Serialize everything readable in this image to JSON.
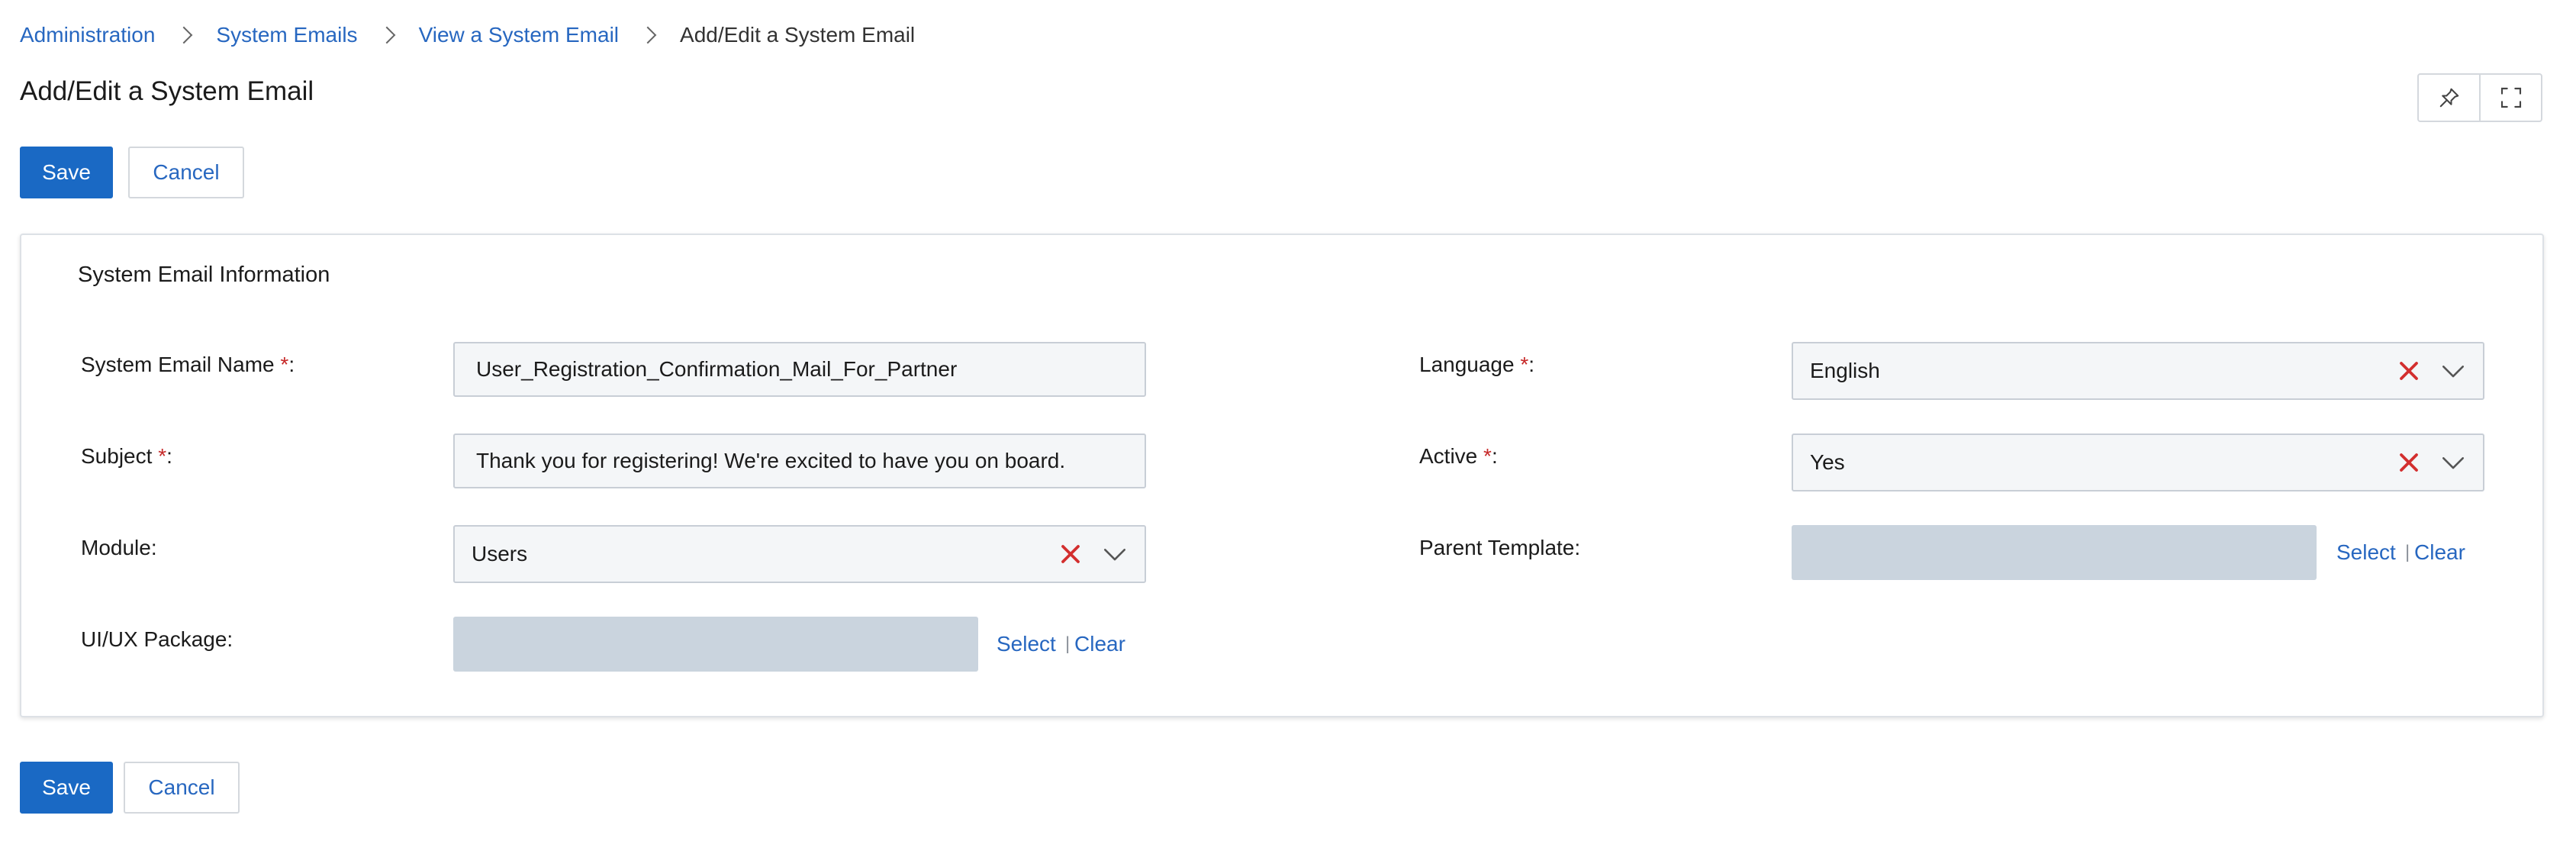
{
  "breadcrumb": {
    "items": [
      "Administration",
      "System Emails",
      "View a System Email"
    ],
    "current": "Add/Edit a System Email"
  },
  "page": {
    "title": "Add/Edit a System Email"
  },
  "actions": {
    "save_label": "Save",
    "cancel_label": "Cancel"
  },
  "toolbar_icons": [
    "pin-icon",
    "fullscreen-icon"
  ],
  "panel": {
    "title": "System Email Information",
    "required_marker": "*",
    "fields": {
      "name": {
        "label": "System Email Name",
        "suffix": ":",
        "value": "User_Registration_Confirmation_Mail_For_Partner"
      },
      "subject": {
        "label": "Subject",
        "suffix": ":",
        "value": "Thank you for registering! We're excited to have you on board."
      },
      "module": {
        "label": "Module:",
        "value": "Users"
      },
      "uiux": {
        "label": "UI/UX Package:",
        "select": "Select",
        "sep": "|",
        "clear": "Clear"
      },
      "language": {
        "label": "Language",
        "suffix": ":",
        "value": "English"
      },
      "active": {
        "label": "Active",
        "suffix": ":",
        "value": "Yes"
      },
      "parent": {
        "label": "Parent Template:",
        "select": "Select",
        "sep": "|",
        "clear": "Clear"
      }
    }
  },
  "colors": {
    "primary": "#1a69c4",
    "link": "#2767c0",
    "required": "#c62828",
    "clear_icon": "#d32f2f"
  }
}
